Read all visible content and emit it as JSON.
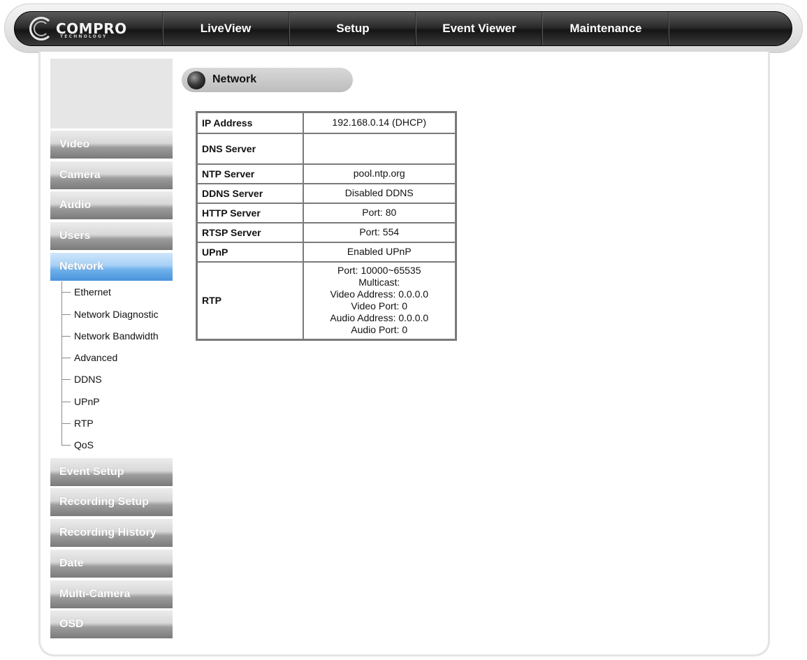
{
  "brand": {
    "name": "COMPRO",
    "tagline": "TECHNOLOGY"
  },
  "nav": {
    "items": [
      {
        "label": "LiveView"
      },
      {
        "label": "Setup"
      },
      {
        "label": "Event Viewer"
      },
      {
        "label": "Maintenance"
      }
    ]
  },
  "sidebar": {
    "items": [
      {
        "label": "Video"
      },
      {
        "label": "Camera"
      },
      {
        "label": "Audio"
      },
      {
        "label": "Users"
      },
      {
        "label": "Network",
        "active": true
      },
      {
        "label": "Event Setup"
      },
      {
        "label": "Recording Setup"
      },
      {
        "label": "Recording History"
      },
      {
        "label": "Date"
      },
      {
        "label": "Multi-Camera"
      },
      {
        "label": "OSD"
      }
    ],
    "network_subitems": [
      {
        "label": "Ethernet"
      },
      {
        "label": "Network Diagnostic"
      },
      {
        "label": "Network Bandwidth"
      },
      {
        "label": "Advanced"
      },
      {
        "label": "DDNS"
      },
      {
        "label": "UPnP"
      },
      {
        "label": "RTP"
      },
      {
        "label": "QoS"
      }
    ]
  },
  "content": {
    "title": "Network",
    "rows": [
      {
        "key": "IP Address",
        "value": "192.168.0.14 (DHCP)"
      },
      {
        "key": "DNS Server",
        "value": ""
      },
      {
        "key": "NTP Server",
        "value": "pool.ntp.org"
      },
      {
        "key": "DDNS Server",
        "value": "Disabled DDNS"
      },
      {
        "key": "HTTP Server",
        "value": "Port: 80"
      },
      {
        "key": "RTSP Server",
        "value": "Port: 554"
      },
      {
        "key": "UPnP",
        "value": "Enabled UPnP"
      }
    ],
    "rtp": {
      "key": "RTP",
      "lines": [
        "Port: 10000~65535",
        "Multicast:",
        "Video Address: 0.0.0.0",
        "Video Port: 0",
        "Audio Address: 0.0.0.0",
        "Audio Port: 0"
      ]
    }
  },
  "colors": {
    "active_item": "#6fb0ec",
    "topbar": "#1e1e1e",
    "sidebar_button": "#9c9c9c"
  }
}
